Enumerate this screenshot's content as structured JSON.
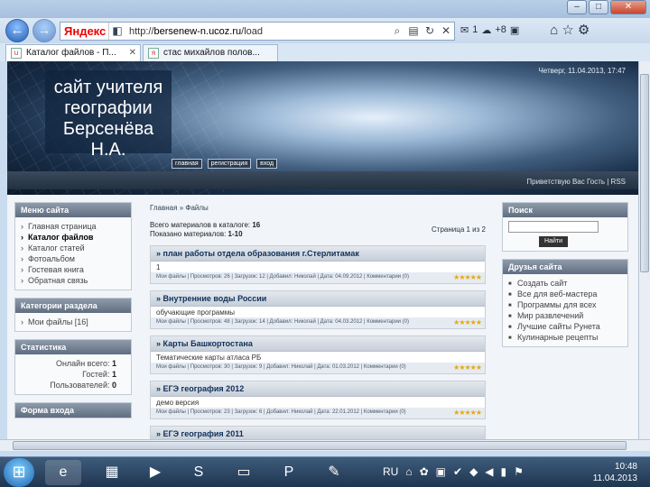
{
  "browser": {
    "url_prefix": "http://",
    "url_domain": "bersenew-n.ucoz.ru",
    "url_path": "/load",
    "yandex": "Яндекс",
    "toolbar_count": "1",
    "toolbar_temp": "+8",
    "tabs": [
      {
        "label": "Каталог файлов - П..."
      },
      {
        "label": "стас михайлов полов..."
      }
    ]
  },
  "header": {
    "site_title": "сайт учителя географии Берсенёва Н.А.",
    "datetime": "Четверг, 11.04.2013, 17:47",
    "nav": [
      "главная",
      "регистрация",
      "вход"
    ],
    "greeting": "Приветствую Вас Гость | RSS"
  },
  "sidebar": {
    "menu_title": "Меню сайта",
    "menu": [
      "Главная страница",
      "Каталог файлов",
      "Каталог статей",
      "Фотоальбом",
      "Гостевая книга",
      "Обратная связь"
    ],
    "cat_title": "Категории раздела",
    "cat_item": "Мои файлы [16]",
    "stat_title": "Статистика",
    "stat": [
      {
        "label": "Онлайн всего:",
        "value": "1"
      },
      {
        "label": "Гостей:",
        "value": "1"
      },
      {
        "label": "Пользователей:",
        "value": "0"
      }
    ],
    "login_title": "Форма входа"
  },
  "rightbar": {
    "search_title": "Поиск",
    "search_btn": "Найти",
    "friends_title": "Друзья сайта",
    "friends": [
      "Создать сайт",
      "Все для веб-мастера",
      "Программы для всех",
      "Мир развлечений",
      "Лучшие сайты Рунета",
      "Кулинарные рецепты"
    ]
  },
  "main": {
    "crumb_home": "Главная",
    "crumb_sep": "»",
    "crumb_current": "Файлы",
    "count1_label": "Всего материалов в каталоге:",
    "count1_value": "16",
    "count2_label": "Показано материалов:",
    "count2_value": "1-10",
    "pages": "Страница 1 из 2",
    "entries": [
      {
        "title": "план работы отдела образования г.Стерлитамак",
        "desc": "1",
        "meta": "Мои файлы | Просмотров: 26 | Загрузок: 12 | Добавил: Николай | Дата: 04.09.2012 | Комментарии (0)"
      },
      {
        "title": "Внутренние воды России",
        "desc": "обучающие программы",
        "meta": "Мои файлы | Просмотров: 48 | Загрузок: 14 | Добавил: Николай | Дата: 04.03.2012 | Комментарии (0)"
      },
      {
        "title": "Карты Башкортостана",
        "desc": "Тематические карты атласа РБ",
        "meta": "Мои файлы | Просмотров: 30 | Загрузок: 9 | Добавил: Николай | Дата: 01.03.2012 | Комментарии (0)"
      },
      {
        "title": "ЕГЭ география 2012",
        "desc": "демо версия",
        "meta": "Мои файлы | Просмотров: 23 | Загрузок: 6 | Добавил: Николай | Дата: 22.01.2012 | Комментарии (0)"
      },
      {
        "title": "ЕГЭ география 2011",
        "desc": "",
        "meta": ""
      }
    ]
  },
  "taskbar": {
    "lang": "RU",
    "time": "10:48",
    "date": "11.04.2013"
  }
}
